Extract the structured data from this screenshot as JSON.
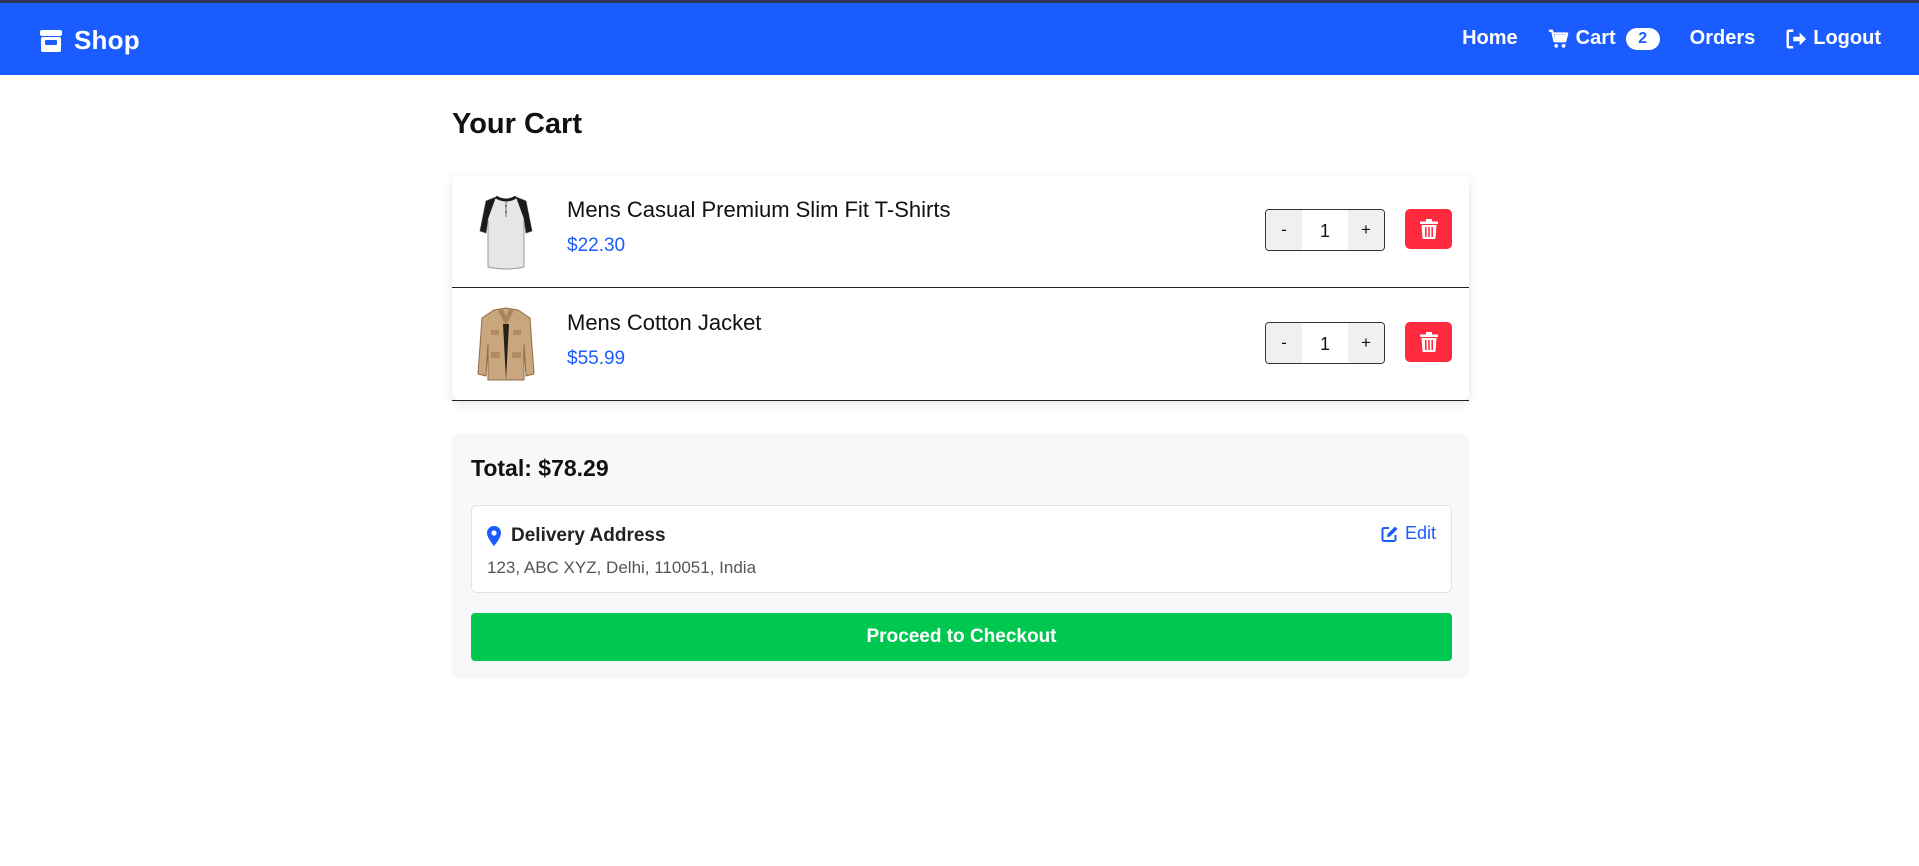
{
  "navbar": {
    "brand": "Shop",
    "brand_icon": "store-icon",
    "links": {
      "home": "Home",
      "cart": "Cart",
      "cart_count": "2",
      "orders": "Orders",
      "logout": "Logout"
    },
    "color": "#1a5cff"
  },
  "page_title": "Your Cart",
  "cart": {
    "items": [
      {
        "name": "Mens Casual Premium Slim Fit T-Shirts",
        "price": "$22.30",
        "quantity": "1",
        "image_icon": "tshirt-image"
      },
      {
        "name": "Mens Cotton Jacket",
        "price": "$55.99",
        "quantity": "1",
        "image_icon": "jacket-image"
      }
    ],
    "minus_label": "-",
    "plus_label": "+"
  },
  "summary": {
    "total": "Total: $78.29",
    "address_title": "Delivery Address",
    "address": "123, ABC XYZ, Delhi, 110051, India",
    "edit_label": "Edit",
    "checkout_label": "Proceed to Checkout"
  },
  "colors": {
    "primary": "#1a5cff",
    "danger": "#ff2a3d",
    "success": "#00c74f"
  }
}
